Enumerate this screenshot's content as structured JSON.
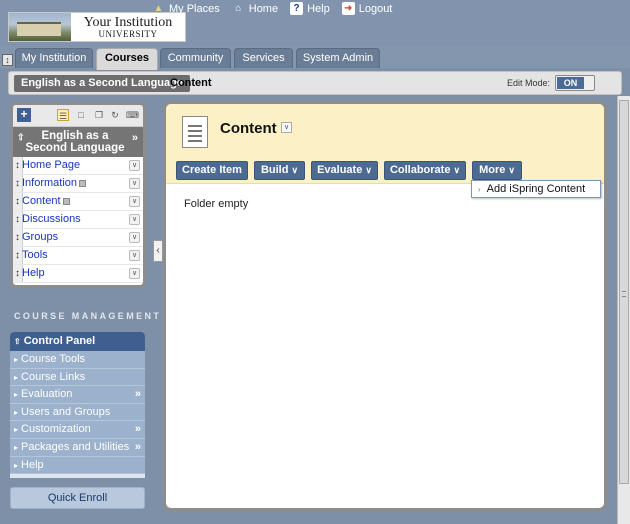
{
  "header": {
    "institution_name": "Your Institution",
    "institution_sub": "UNIVERSITY",
    "links": [
      {
        "label": "My Places",
        "icon": "places-icon"
      },
      {
        "label": "Home",
        "icon": "home-icon"
      },
      {
        "label": "Help",
        "icon": "help-icon"
      },
      {
        "label": "Logout",
        "icon": "logout-icon"
      }
    ]
  },
  "tabs": [
    {
      "label": "My Institution",
      "active": false
    },
    {
      "label": "Courses",
      "active": true
    },
    {
      "label": "Community",
      "active": false
    },
    {
      "label": "Services",
      "active": false
    },
    {
      "label": "System Admin",
      "active": false
    }
  ],
  "breadcrumb": {
    "course": "English as a Second Language",
    "current": "Content",
    "edit_mode_label": "Edit Mode:",
    "edit_mode_value": "ON"
  },
  "course_menu": {
    "title": "English as a Second Language",
    "items": [
      {
        "label": "Home Page",
        "has_plus": false
      },
      {
        "label": "Information",
        "has_plus": true
      },
      {
        "label": "Content",
        "has_plus": true
      },
      {
        "label": "Discussions",
        "has_plus": false
      },
      {
        "label": "Groups",
        "has_plus": false
      },
      {
        "label": "Tools",
        "has_plus": false
      },
      {
        "label": "Help",
        "has_plus": false
      }
    ]
  },
  "course_management": {
    "section_title": "COURSE MANAGEMENT",
    "panel_title": "Control Panel",
    "items": [
      {
        "label": "Course Tools",
        "expandable": false
      },
      {
        "label": "Course Links",
        "expandable": false
      },
      {
        "label": "Evaluation",
        "expandable": true
      },
      {
        "label": "Users and Groups",
        "expandable": false
      },
      {
        "label": "Customization",
        "expandable": true
      },
      {
        "label": "Packages and Utilities",
        "expandable": true
      },
      {
        "label": "Help",
        "expandable": false
      }
    ],
    "quick_enroll": "Quick Enroll"
  },
  "content": {
    "title": "Content",
    "action_buttons": [
      {
        "label": "Create Item",
        "has_chevron": false
      },
      {
        "label": "Build",
        "has_chevron": true
      },
      {
        "label": "Evaluate",
        "has_chevron": true
      },
      {
        "label": "Collaborate",
        "has_chevron": true
      },
      {
        "label": "More",
        "has_chevron": true
      }
    ],
    "more_menu_items": [
      "Add iSpring Content"
    ],
    "empty_message": "Folder empty"
  },
  "colors": {
    "header_bg": "#8294ad",
    "button_blue": "#4d6a92",
    "content_header_bg": "#fcf0c6",
    "link_blue": "#1736b8",
    "control_panel_header": "#3f5f8f"
  }
}
